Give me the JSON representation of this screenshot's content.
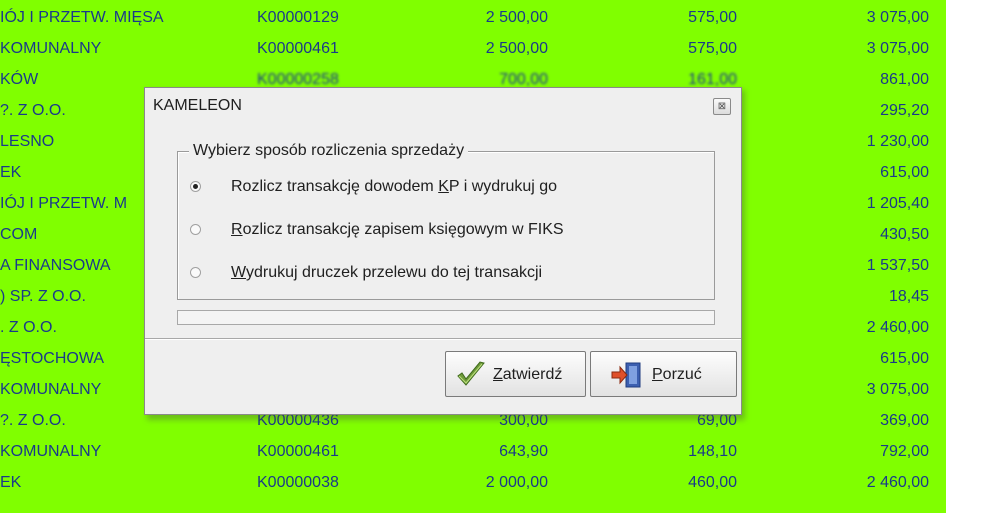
{
  "grid": {
    "rows": [
      {
        "name": "IÓJ I PRZETW. MIĘSA",
        "code": "K00000129",
        "net": "2 500,00",
        "vat": "575,00",
        "gross": "3 075,00"
      },
      {
        "name": "KOMUNALNY",
        "code": "K00000461",
        "net": "2 500,00",
        "vat": "575,00",
        "gross": "3 075,00"
      },
      {
        "name": "KÓW",
        "code": "K00000258",
        "net": "700,00",
        "vat": "161,00",
        "gross": "861,00"
      },
      {
        "name": "?. Z O.O.",
        "code": "",
        "net": "",
        "vat": "",
        "gross": "295,20"
      },
      {
        "name": "LESNO",
        "code": "",
        "net": "",
        "vat": "",
        "gross": "1 230,00"
      },
      {
        "name": "EK",
        "code": "",
        "net": "",
        "vat": "",
        "gross": "615,00"
      },
      {
        "name": "IÓJ I PRZETW. M",
        "code": "",
        "net": "",
        "vat": "",
        "gross": "1 205,40"
      },
      {
        "name": "COM",
        "code": "",
        "net": "",
        "vat": "",
        "gross": "430,50"
      },
      {
        "name": "A FINANSOWA",
        "code": "",
        "net": "",
        "vat": "",
        "gross": "1 537,50"
      },
      {
        "name": ") SP. Z O.O.",
        "code": "",
        "net": "",
        "vat": "",
        "gross": "18,45"
      },
      {
        "name": ". Z O.O.",
        "code": "",
        "net": "",
        "vat": "",
        "gross": "2 460,00"
      },
      {
        "name": "ĘSTOCHOWA",
        "code": "",
        "net": "",
        "vat": "",
        "gross": "615,00"
      },
      {
        "name": "KOMUNALNY",
        "code": "K00000461",
        "net": "2 500,00",
        "vat": "575,00",
        "gross": "3 075,00"
      },
      {
        "name": "?. Z O.O.",
        "code": "K00000436",
        "net": "300,00",
        "vat": "69,00",
        "gross": "369,00"
      },
      {
        "name": "KOMUNALNY",
        "code": "K00000461",
        "net": "643,90",
        "vat": "148,10",
        "gross": "792,00"
      },
      {
        "name": "EK",
        "code": "K00000038",
        "net": "2 000,00",
        "vat": "460,00",
        "gross": "2 460,00"
      }
    ]
  },
  "dialog": {
    "title": "KAMELEON",
    "close_glyph": "⊠",
    "group_label": "Wybierz sposób rozliczenia sprzedaży",
    "options": [
      {
        "label_pre": "Rozlicz transakcję dowodem ",
        "label_key": "K",
        "label_post": "P i wydrukuj go",
        "selected": true
      },
      {
        "label_pre": "",
        "label_key": "R",
        "label_post": "ozlicz transakcję zapisem księgowym w FIKS",
        "selected": false
      },
      {
        "label_pre": "",
        "label_key": "W",
        "label_post": "ydrukuj druczek przelewu do tej transakcji",
        "selected": false
      }
    ],
    "progress": 0,
    "ok_button": {
      "key": "Z",
      "rest": "atwierdź"
    },
    "cancel_button": {
      "key": "P",
      "rest": "orzuć"
    }
  },
  "colors": {
    "grid_background": "#80ff00",
    "grid_text": "#1a3a8a",
    "dialog_background": "#efefef"
  }
}
